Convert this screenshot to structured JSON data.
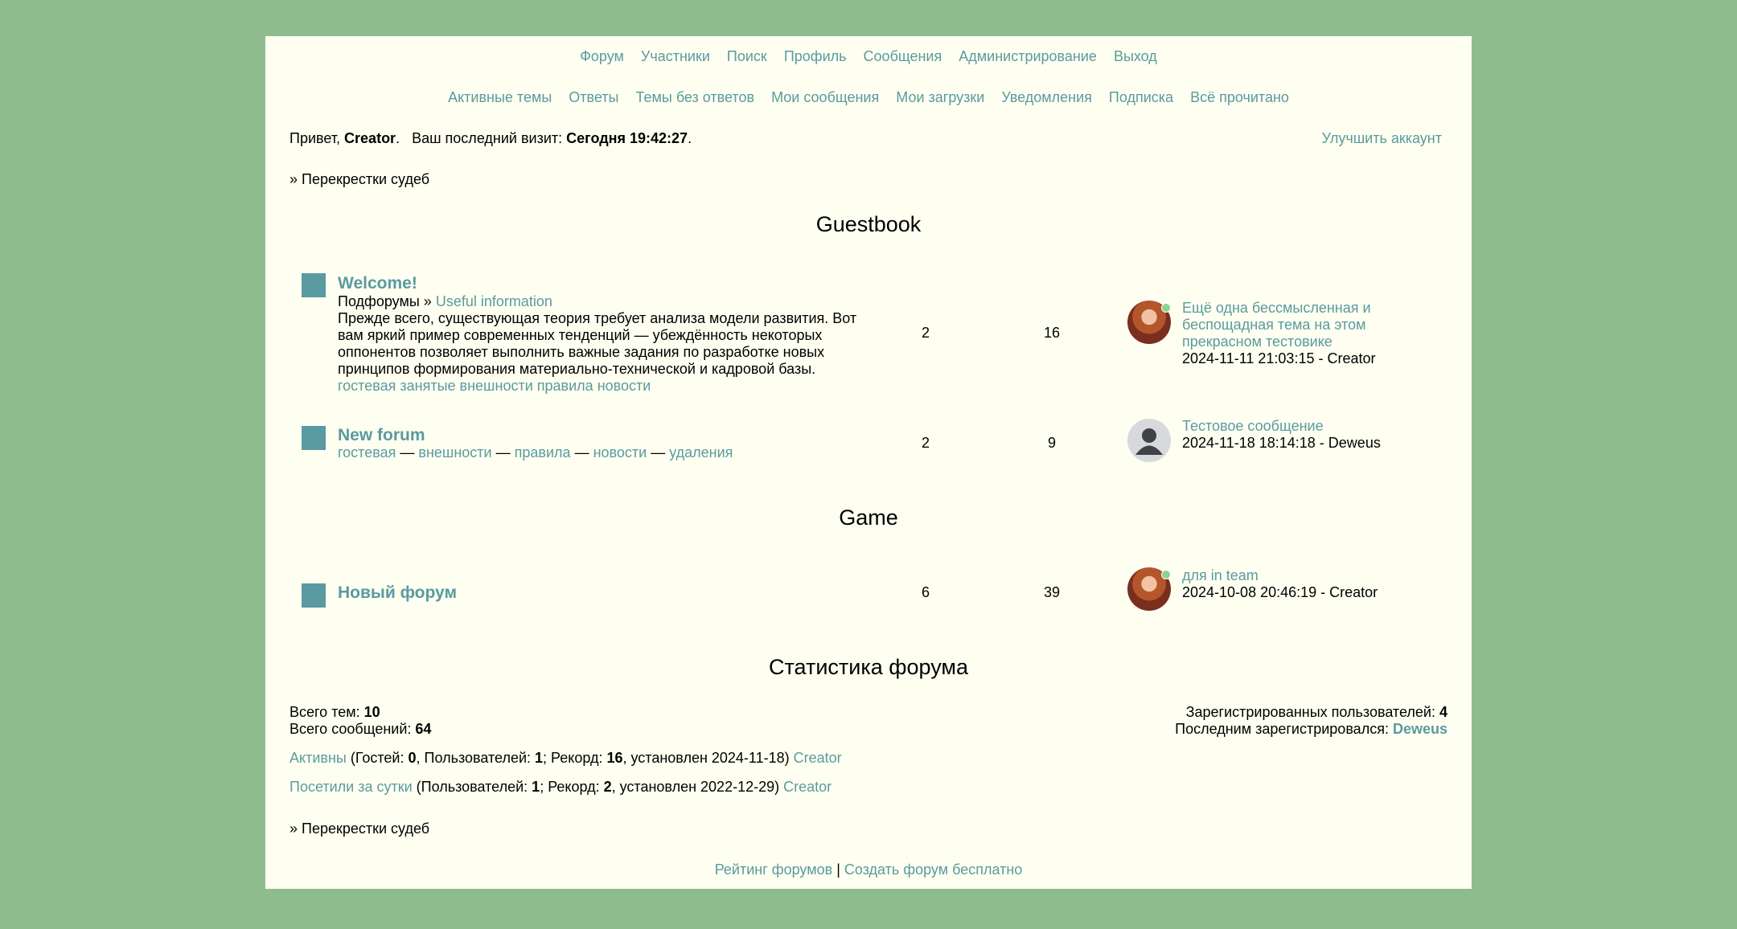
{
  "nav_main": [
    "Форум",
    "Участники",
    "Поиск",
    "Профиль",
    "Сообщения",
    "Администрирование",
    "Выход"
  ],
  "nav_sub": [
    "Активные темы",
    "Ответы",
    "Темы без ответов",
    "Мои сообщения",
    "Мои загрузки",
    "Уведомления",
    "Подписка",
    "Всё прочитано"
  ],
  "greeting": {
    "prefix": "Привет,",
    "user": "Creator",
    "visit_label": "Ваш последний визит:",
    "visit_value": "Сегодня 19:42:27",
    "upgrade": "Улучшить аккаунт"
  },
  "breadcrumb": "» Перекрестки судеб",
  "sections": [
    {
      "title": "Guestbook",
      "forums": [
        {
          "name": "Welcome!",
          "subforums_label": "Подфорумы »",
          "subforum": "Useful information",
          "description": "Прежде всего, существующая теория требует анализа модели развития. Вот вам яркий пример современных тенденций — убеждённость некоторых оппонентов позволяет выполнить важные задания по разработке новых принципов формирования материально-технической и кадровой базы.",
          "tags": [
            "гостевая",
            "занятые",
            "внешности",
            "правила",
            "новости"
          ],
          "topics": "2",
          "posts": "16",
          "last_topic": "Ещё одна бессмысленная и беспощадная тема на этом прекрасном тестовике",
          "last_meta": "2024-11-11 21:03:15 - Creator"
        },
        {
          "name": "New forum",
          "links": [
            "гостевая",
            "внешности",
            "правила",
            "новости",
            "удаления"
          ],
          "separator": "—",
          "topics": "2",
          "posts": "9",
          "last_topic": "Тестовое сообщение",
          "last_meta": "2024-11-18 18:14:18 - Deweus"
        }
      ]
    },
    {
      "title": "Game",
      "forums": [
        {
          "name": "Новый форум",
          "topics": "6",
          "posts": "39",
          "last_topic": "для in team",
          "last_meta": "2024-10-08 20:46:19 - Creator"
        }
      ]
    }
  ],
  "stats": {
    "title": "Статистика форума",
    "total_topics_label": "Всего тем:",
    "total_topics": "10",
    "total_posts_label": "Всего сообщений:",
    "total_posts": "64",
    "registered_label": "Зарегистрированных пользователей:",
    "registered": "4",
    "last_reg_label": "Последним зарегистрировался:",
    "last_reg": "Deweus",
    "active_link": "Активны",
    "active_p1": " (Гостей: ",
    "active_guests": "0",
    "active_p2": ", Пользователей: ",
    "active_users": "1",
    "active_p3": "; Рекорд: ",
    "active_record": "16",
    "active_p4": ", установлен 2024-11-18) ",
    "active_user": "Creator",
    "day_link": "Посетили за сутки",
    "day_p1": " (Пользователей: ",
    "day_users": "1",
    "day_p2": "; Рекорд: ",
    "day_record": "2",
    "day_p3": ", установлен 2022-12-29) ",
    "day_user": "Creator"
  },
  "footer": {
    "rating": "Рейтинг форумов",
    "sep": "|",
    "create": "Создать форум бесплатно"
  },
  "colors": {
    "background": "#8fbc8f",
    "page": "#fefff0",
    "link": "#5a9aa1"
  }
}
